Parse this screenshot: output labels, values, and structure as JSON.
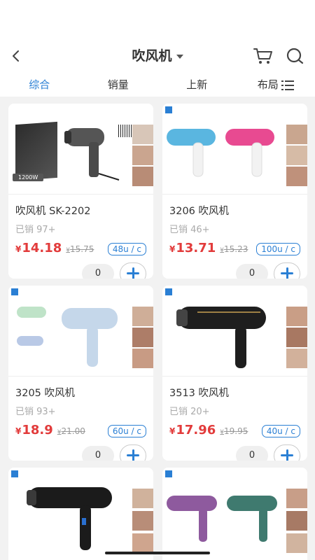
{
  "nav": {
    "title": "吹风机"
  },
  "tabs": [
    "综合",
    "销量",
    "上新",
    "布局"
  ],
  "products": [
    {
      "name": "吹风机 SK-2202",
      "sold": "已销 97+",
      "currency": "¥",
      "price": "14.18",
      "old_price": "15.75",
      "units": "48u / c",
      "qty": "0",
      "image": "black-dryer",
      "badge": "1200W"
    },
    {
      "name": "3206 吹风机",
      "sold": "已销 46+",
      "currency": "¥",
      "price": "13.71",
      "old_price": "15.23",
      "units": "100u / c",
      "qty": "0",
      "image": "blue-pink-dryer"
    },
    {
      "name": "3205 吹风机",
      "sold": "已销 93+",
      "currency": "¥",
      "price": "18.9",
      "old_price": "21.00",
      "units": "60u / c",
      "qty": "0",
      "image": "green-blue-dryer"
    },
    {
      "name": "3513 吹风机",
      "sold": "已销 20+",
      "currency": "¥",
      "price": "17.96",
      "old_price": "19.95",
      "units": "40u / c",
      "qty": "0",
      "image": "black-pro-dryer"
    }
  ],
  "colors": {
    "accent": "#2a7fd4",
    "price": "#e23b3b"
  }
}
